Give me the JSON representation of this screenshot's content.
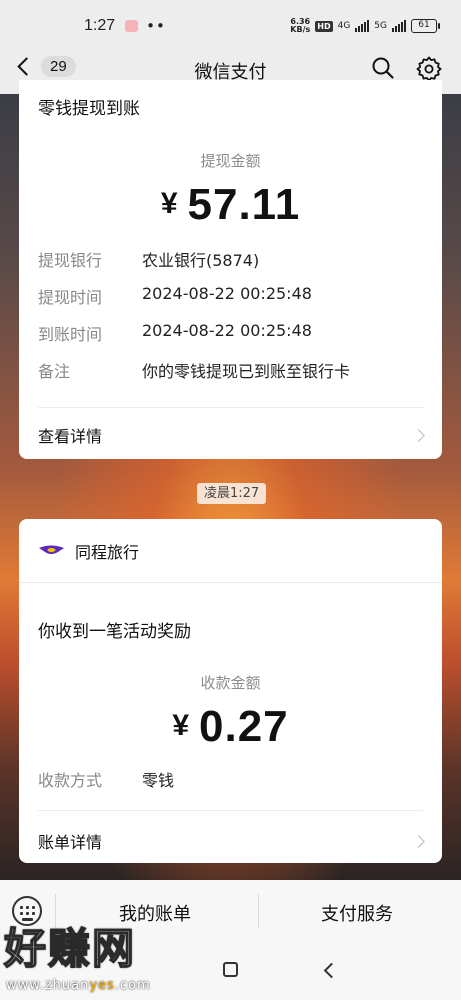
{
  "status_bar": {
    "time": "1:27",
    "dots": "••",
    "net_speed_value": "6.36",
    "net_speed_unit": "KB/s",
    "hd_label": "HD",
    "net1": "4G",
    "net2": "5G",
    "battery": "61"
  },
  "nav": {
    "back_count": "29",
    "title": "微信支付",
    "search_icon": "search-icon",
    "settings_icon": "gear-icon"
  },
  "withdraw_card": {
    "title": "零钱提现到账",
    "amount_label": "提现金额",
    "currency": "¥",
    "amount": "57.11",
    "details": [
      {
        "key": "提现银行",
        "value": "农业银行(5874)"
      },
      {
        "key": "提现时间",
        "value": "2024-08-22 00:25:48"
      },
      {
        "key": "到账时间",
        "value": "2024-08-22 00:25:48"
      },
      {
        "key": "备注",
        "value": "你的零钱提现已到账至银行卡"
      }
    ],
    "link_label": "查看详情"
  },
  "time_chip": "凌晨1:27",
  "reward_card": {
    "merchant": "同程旅行",
    "message": "你收到一笔活动奖励",
    "amount_label": "收款金额",
    "currency": "¥",
    "amount": "0.27",
    "method_key": "收款方式",
    "method_value": "零钱",
    "link_label": "账单详情"
  },
  "bottom_tabs": {
    "tab1": "我的账单",
    "tab2": "支付服务"
  },
  "watermark": {
    "big_text": "好赚网",
    "url_part1": "www.zhuan",
    "url_part2": "yes",
    "url_part3": ".com"
  },
  "colors": {
    "bar_bg": "#ededed",
    "card_bg": "#ffffff",
    "muted_text": "#888888",
    "merchant_logo": "#5b2bbf"
  }
}
